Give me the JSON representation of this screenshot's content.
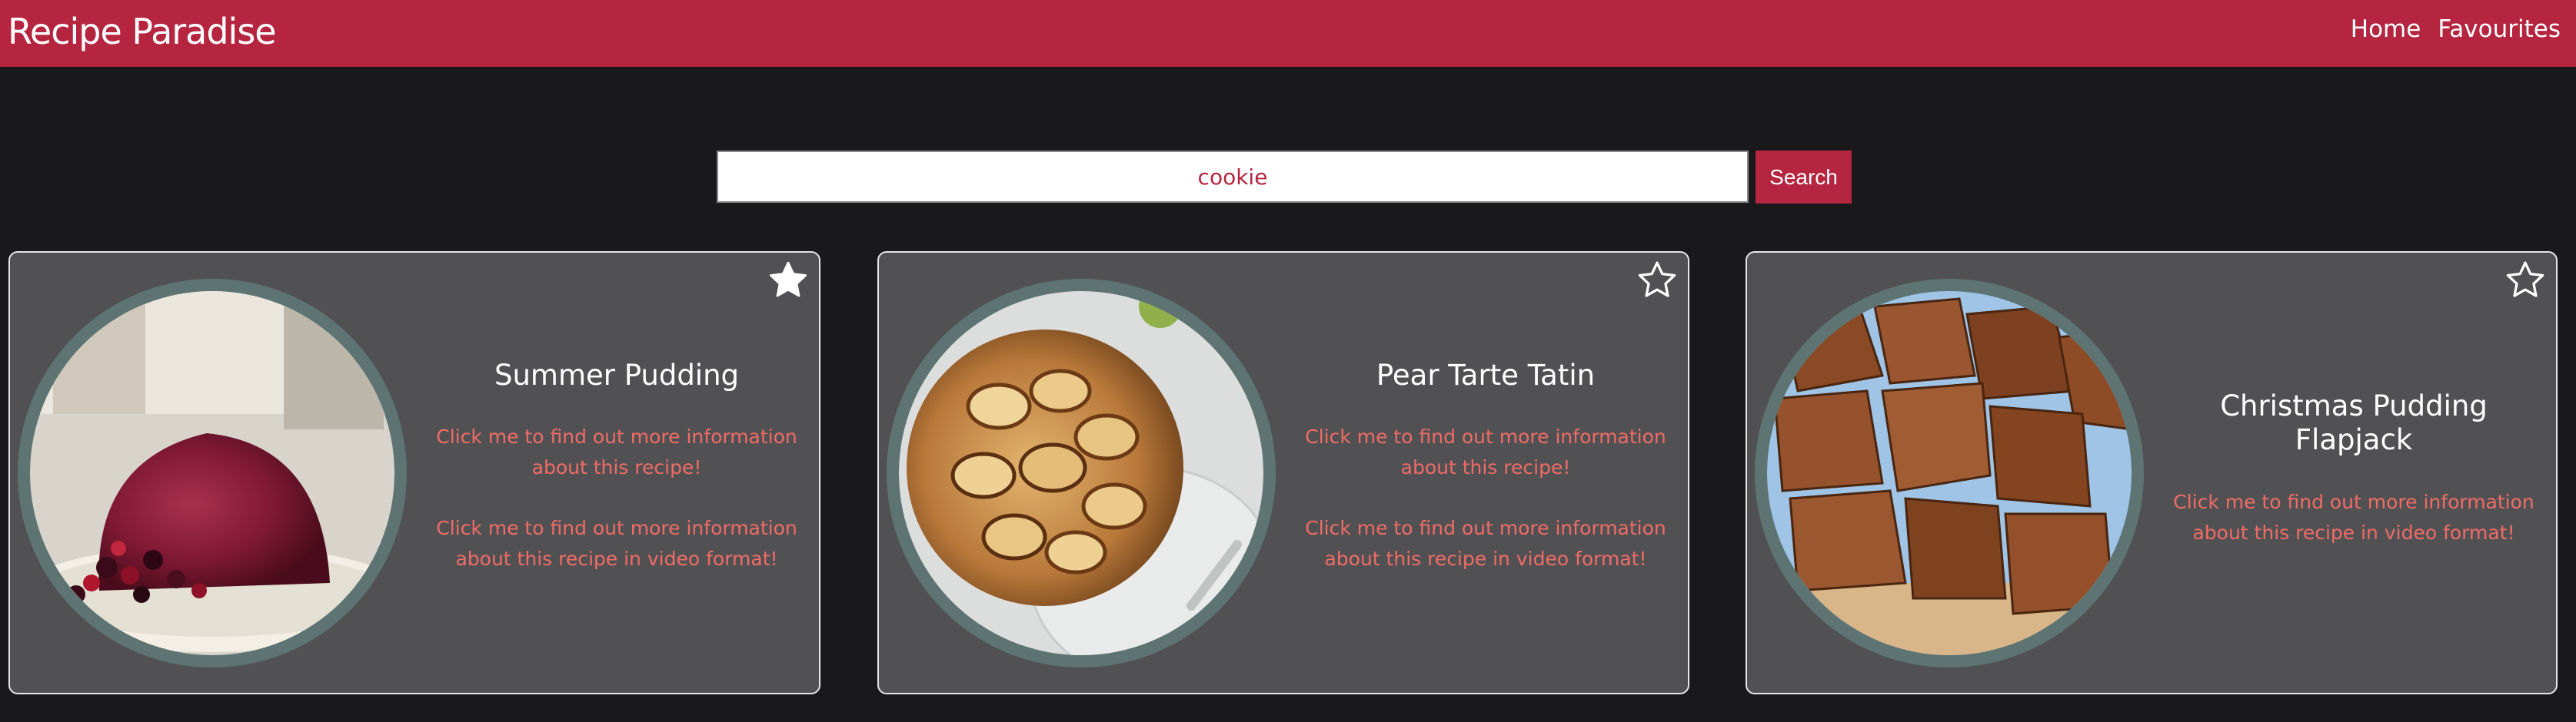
{
  "brand": "Recipe Paradise",
  "nav": {
    "home": "Home",
    "favourites": "Favourites"
  },
  "search": {
    "value": "cookie",
    "button_label": "Search"
  },
  "colors": {
    "navbar": "#b52540",
    "background": "#19191b",
    "card": "#515154",
    "photo_ring": "#5d7473",
    "link_text": "#f06c66"
  },
  "recipes": [
    {
      "title": "Summer Pudding",
      "info_link": "Click me to find out more information about this recipe!",
      "video_link": "Click me to find out more information about this recipe in video format!",
      "favourite": true,
      "icon": "star-filled-icon"
    },
    {
      "title": "Pear Tarte Tatin",
      "info_link": "Click me to find out more information about this recipe!",
      "video_link": "Click me to find out more information about this recipe in video format!",
      "favourite": false,
      "icon": "star-outline-icon"
    },
    {
      "title": "Christmas Pudding Flapjack",
      "video_link": "Click me to find out more information about this recipe in video format!",
      "favourite": false,
      "icon": "star-outline-icon"
    }
  ]
}
